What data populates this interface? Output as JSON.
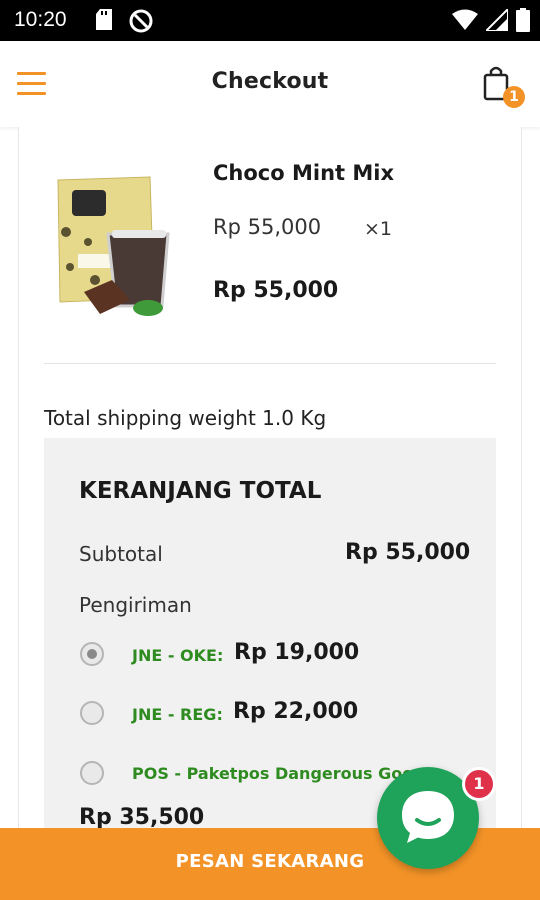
{
  "status_bar": {
    "time": "10:20",
    "icons": [
      "sd-card-icon",
      "sync-icon",
      "wifi-icon",
      "signal-icon",
      "battery-icon"
    ]
  },
  "app_bar": {
    "title": "Checkout",
    "menu_icon": "hamburger-menu-icon",
    "cart_icon": "shopping-bag-icon",
    "cart_count": "1"
  },
  "cart_item": {
    "name": "Choco Mint Mix",
    "unit_price": "Rp 55,000",
    "quantity": "×1",
    "line_total": "Rp 55,000"
  },
  "shipping_weight": "Total shipping weight 1.0 Kg",
  "totals": {
    "heading": "KERANJANG TOTAL",
    "subtotal_label": "Subtotal",
    "subtotal_value": "Rp 55,000",
    "shipping_label": "Pengiriman",
    "shipping_options": [
      {
        "name": "JNE - OKE:",
        "price": "Rp 19,000",
        "selected": true
      },
      {
        "name": "JNE - REG:",
        "price": "Rp 22,000",
        "selected": false
      },
      {
        "name": "POS - Paketpos Dangerous Goods:",
        "price": "Rp 35,500",
        "selected": false
      }
    ]
  },
  "order_button": "PESAN SEKARANG",
  "chat": {
    "icon": "chat-bubble-icon",
    "unread": "1"
  },
  "colors": {
    "accent": "#f39327",
    "shipping_text": "#2e8b20",
    "chat_button": "#1fa35a",
    "chat_badge": "#e0314a"
  }
}
